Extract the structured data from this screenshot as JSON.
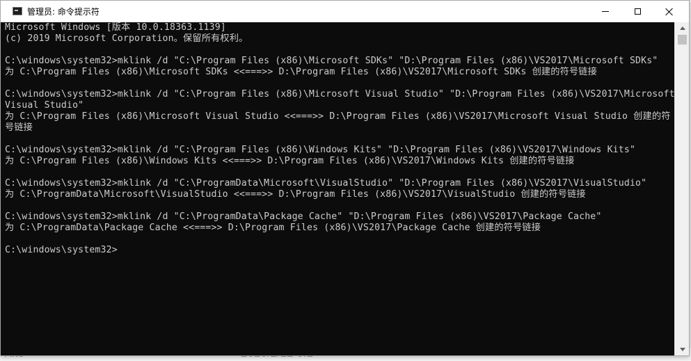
{
  "window": {
    "title": "管理员: 命令提示符",
    "icon": "cmd-icon"
  },
  "console": {
    "lines": [
      "Microsoft Windows [版本 10.0.18363.1139]",
      "(c) 2019 Microsoft Corporation。保留所有权利。",
      "",
      "C:\\windows\\system32>mklink /d \"C:\\Program Files (x86)\\Microsoft SDKs\" \"D:\\Program Files (x86)\\VS2017\\Microsoft SDKs\"",
      "为 C:\\Program Files (x86)\\Microsoft SDKs <<===>> D:\\Program Files (x86)\\VS2017\\Microsoft SDKs 创建的符号链接",
      "",
      "C:\\windows\\system32>mklink /d \"C:\\Program Files (x86)\\Microsoft Visual Studio\" \"D:\\Program Files (x86)\\VS2017\\Microsoft",
      "Visual Studio\"",
      "为 C:\\Program Files (x86)\\Microsoft Visual Studio <<===>> D:\\Program Files (x86)\\VS2017\\Microsoft Visual Studio 创建的符",
      "号链接",
      "",
      "C:\\windows\\system32>mklink /d \"C:\\Program Files (x86)\\Windows Kits\" \"D:\\Program Files (x86)\\VS2017\\Windows Kits\"",
      "为 C:\\Program Files (x86)\\Windows Kits <<===>> D:\\Program Files (x86)\\VS2017\\Windows Kits 创建的符号链接",
      "",
      "C:\\windows\\system32>mklink /d \"C:\\ProgramData\\Microsoft\\VisualStudio\" \"D:\\Program Files (x86)\\VS2017\\VisualStudio\"",
      "为 C:\\ProgramData\\Microsoft\\VisualStudio <<===>> D:\\Program Files (x86)\\VS2017\\VisualStudio 创建的符号链接",
      "",
      "C:\\windows\\system32>mklink /d \"C:\\ProgramData\\Package Cache\" \"D:\\Program Files (x86)\\VS2017\\Package Cache\"",
      "为 C:\\ProgramData\\Package Cache <<===>> D:\\Program Files (x86)\\VS2017\\Package Cache 创建的符号链接",
      "",
      "C:\\windows\\system32>"
    ]
  },
  "background_app": {
    "name_fragment": "Kits",
    "date_fragment": "2020/2/12 0:1"
  },
  "colors": {
    "console_bg": "#0c0c0c",
    "console_fg": "#cccccc"
  }
}
